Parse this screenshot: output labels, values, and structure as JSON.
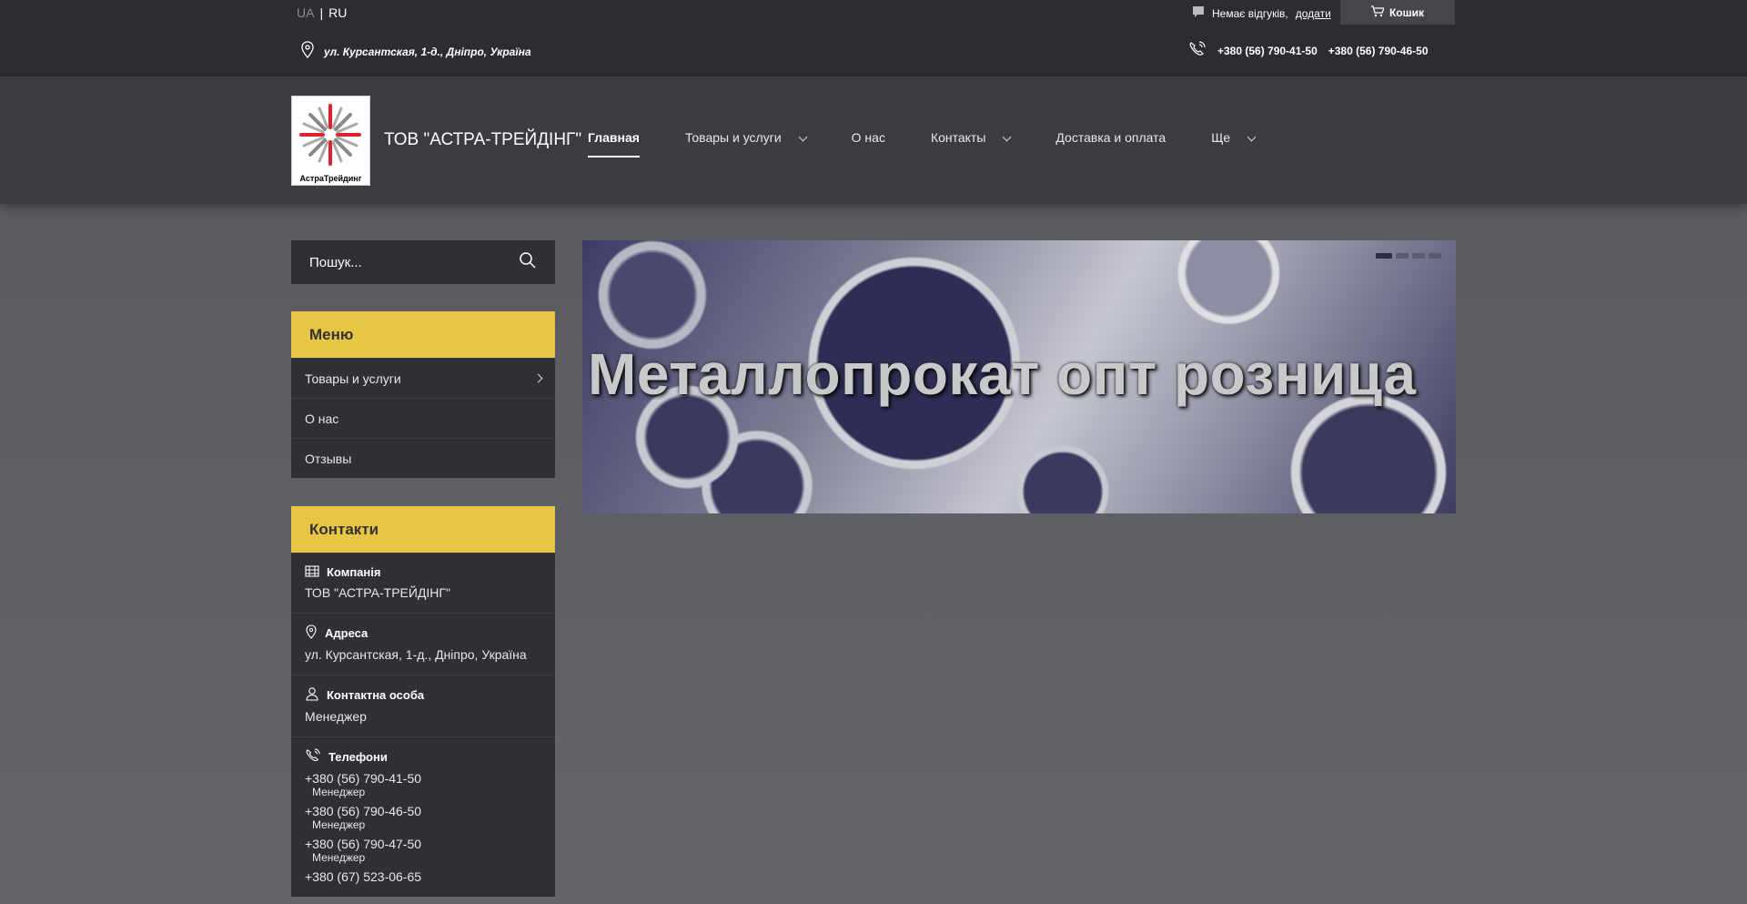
{
  "topbar": {
    "lang_ua": "UA",
    "lang_sep": "|",
    "lang_ru": "RU",
    "reviews_text": "Немає відгуків,",
    "reviews_add": "додати",
    "cart_label": "Кошик",
    "address": "ул. Курсантская, 1-д., Дніпро, Україна",
    "phone1": "+380 (56) 790-41-50",
    "phone2": "+380 (56) 790-46-50"
  },
  "header": {
    "logo_text": "АстраТрейдинг",
    "company_name": "ТОВ \"АСТРА-ТРЕЙДІНГ\"",
    "nav": [
      {
        "label": "Главная"
      },
      {
        "label": "Товары и услуги"
      },
      {
        "label": "О нас"
      },
      {
        "label": "Контакты"
      },
      {
        "label": "Доставка и оплата"
      },
      {
        "label": "Ще"
      }
    ]
  },
  "search": {
    "placeholder": "Пошук..."
  },
  "menu": {
    "title": "Меню",
    "items": [
      {
        "label": "Товары и услуги"
      },
      {
        "label": "О нас"
      },
      {
        "label": "Отзывы"
      }
    ]
  },
  "contacts": {
    "title": "Контакти",
    "company_label": "Компанія",
    "company_value": "ТОВ \"АСТРА-ТРЕЙДІНГ\"",
    "address_label": "Адреса",
    "address_value": "ул. Курсантская, 1-д., Дніпро, Україна",
    "person_label": "Контактна особа",
    "person_value": "Менеджер",
    "phones_label": "Телефони",
    "phones": [
      {
        "number": "+380 (56) 790-41-50",
        "note": "Менеджер"
      },
      {
        "number": "+380 (56) 790-46-50",
        "note": "Менеджер"
      },
      {
        "number": "+380 (56) 790-47-50",
        "note": "Менеджер"
      },
      {
        "number": "+380 (67) 523-06-65",
        "note": ""
      }
    ]
  },
  "slider": {
    "caption": "Металлопрокат опт розница"
  },
  "colors": {
    "accent": "#e8c545",
    "topbar_bg": "#2c2d30",
    "header_bg": "#3a3c40",
    "panel_bg": "#2f3034"
  }
}
